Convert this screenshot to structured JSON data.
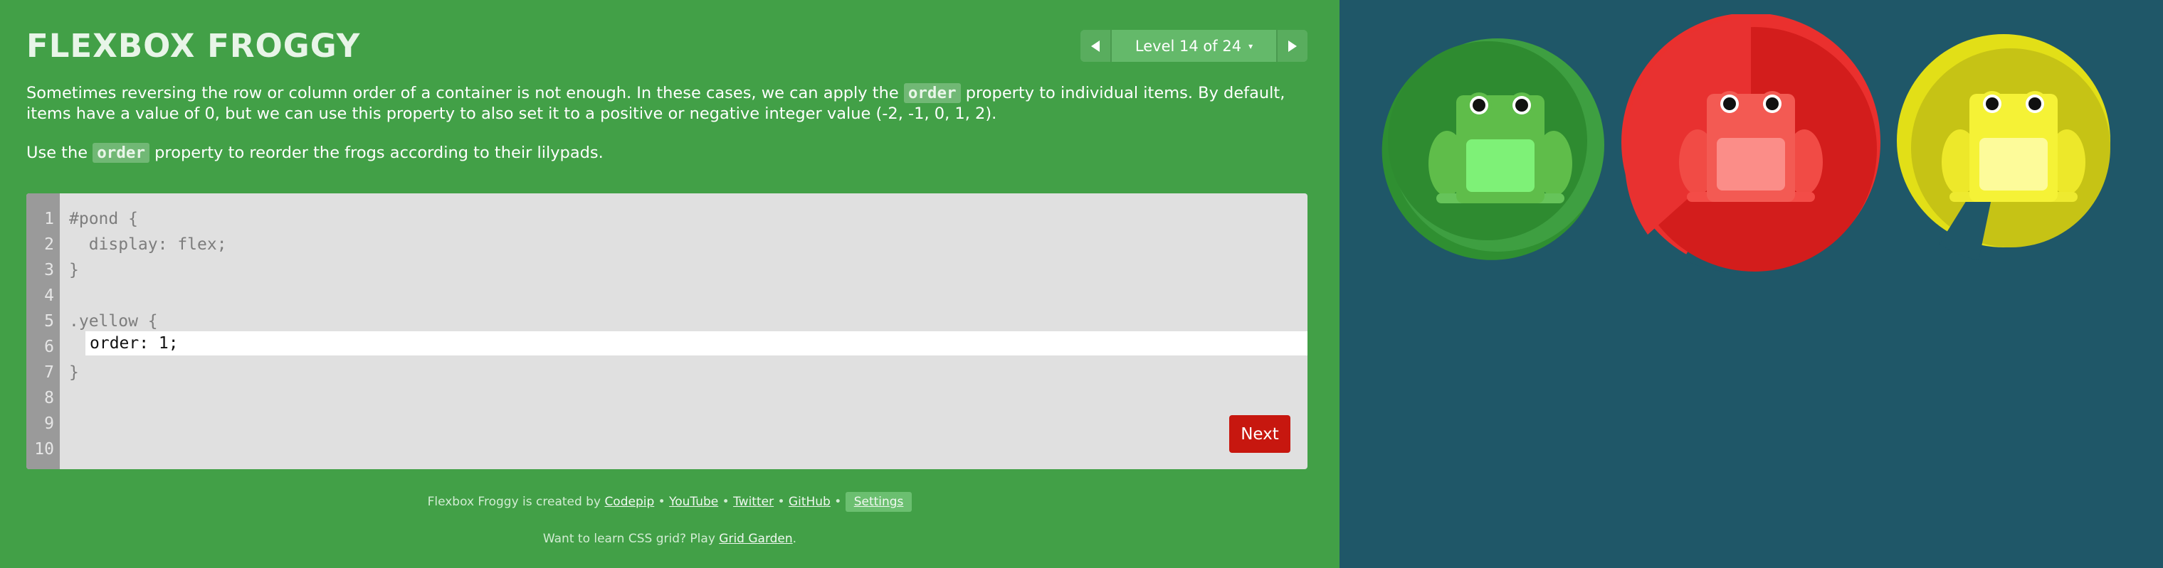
{
  "header": {
    "title": "FLEXBOX FROGGY",
    "level_label": "Level 14 of 24",
    "level_caret": "▾"
  },
  "instructions": {
    "p1_before": "Sometimes reversing the row or column order of a container is not enough. In these cases, we can apply the ",
    "p1_code": "order",
    "p1_after": " property to individual items. By default, items have a value of 0, but we can use this property to also set it to a positive or negative integer value (-2, -1, 0, 1, 2).",
    "p2_before": "Use the ",
    "p2_code": "order",
    "p2_after": " property to reorder the frogs according to their lilypads."
  },
  "editor": {
    "line_numbers": [
      "1",
      "2",
      "3",
      "4",
      "5",
      "6",
      "7",
      "8",
      "9",
      "10"
    ],
    "lines": [
      "#pond {",
      "  display: flex;",
      "}",
      "",
      ".yellow {",
      "",
      "}",
      "",
      "",
      ""
    ],
    "input_value": "order: 1;",
    "next_label": "Next"
  },
  "footer": {
    "credit_text": "Flexbox Froggy is created by ",
    "codepip": "Codepip",
    "youtube": "YouTube",
    "twitter": "Twitter",
    "github": "GitHub",
    "separator": " • ",
    "settings": "Settings",
    "learn_before": "Want to learn CSS grid? Play ",
    "grid_garden": "Grid Garden",
    "learn_after": "."
  },
  "pond": {
    "pads": [
      "green",
      "red",
      "yellow"
    ],
    "frogs": [
      "green",
      "red",
      "yellow"
    ]
  },
  "colors": {
    "sidebar_bg": "#42a047",
    "pond_bg": "#1f5768",
    "next_button": "#c7170f",
    "green_pad": "#2f8f31",
    "red_pad": "#e02a29",
    "yellow_pad": "#d6d41a"
  }
}
